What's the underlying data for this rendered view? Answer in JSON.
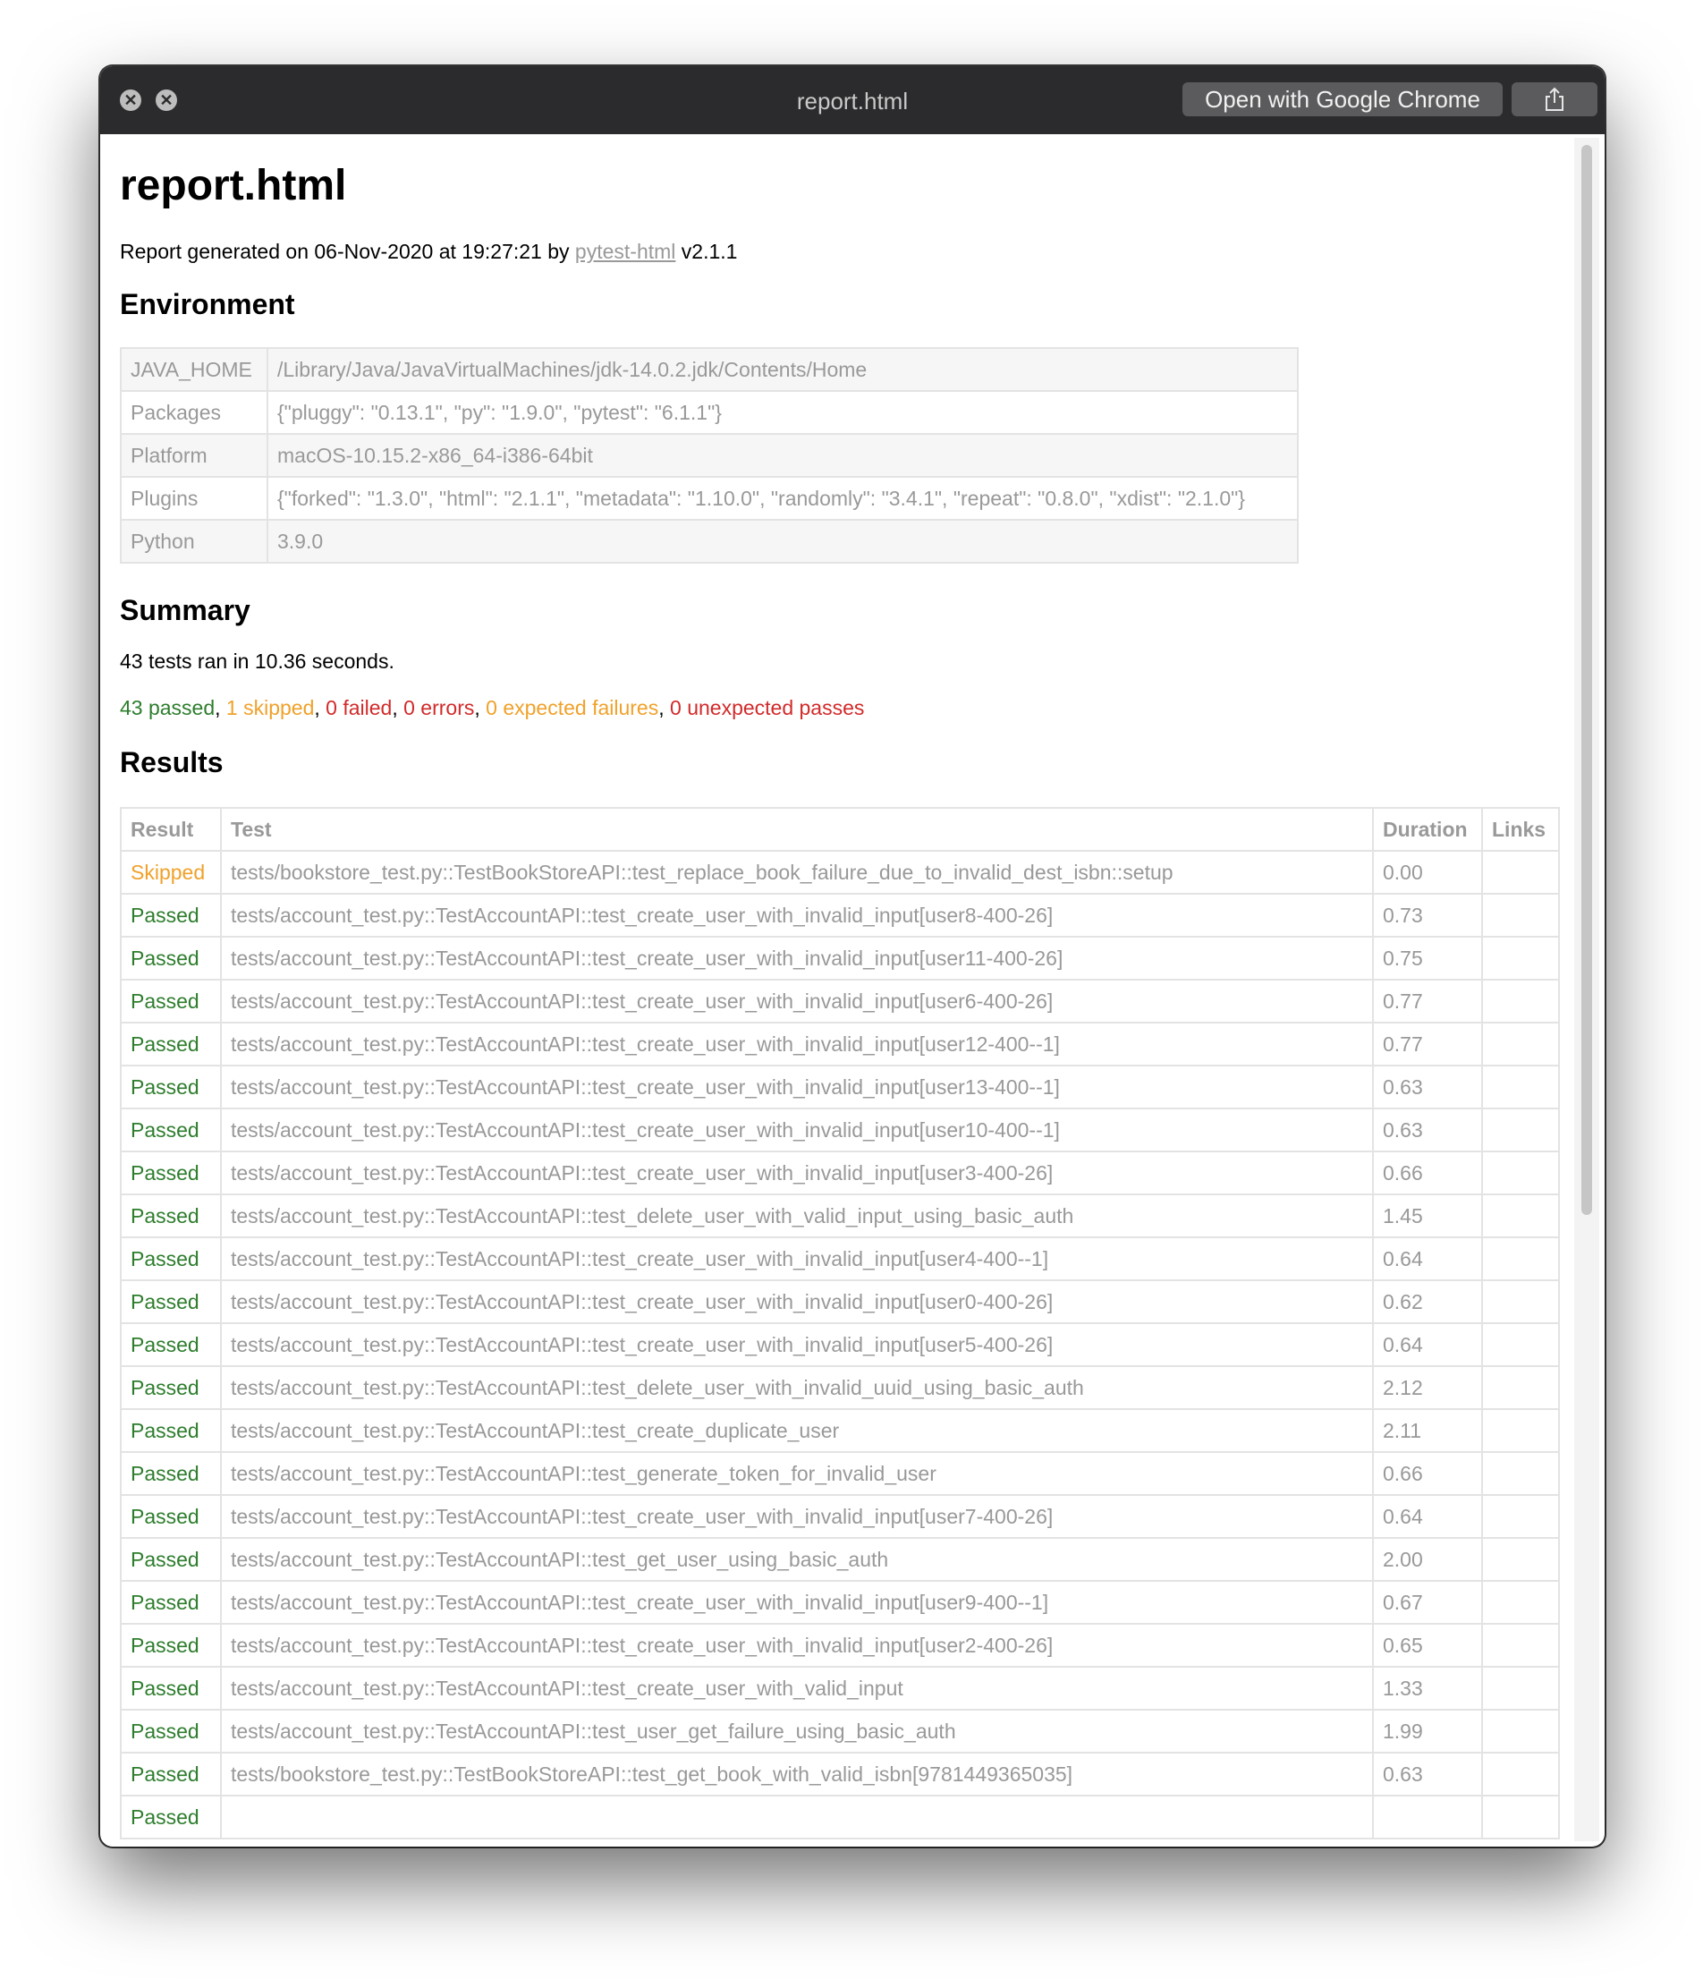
{
  "window": {
    "title": "report.html",
    "open_button": "Open with Google Chrome",
    "close_glyph": "✕",
    "minimize_glyph": "✕"
  },
  "page": {
    "heading": "report.html",
    "generated_prefix": "Report generated on 06-Nov-2020 at 19:27:21 by ",
    "generator_link": "pytest-html",
    "generated_suffix": " v2.1.1"
  },
  "environment": {
    "heading": "Environment",
    "rows": [
      {
        "key": "JAVA_HOME",
        "value": "/Library/Java/JavaVirtualMachines/jdk-14.0.2.jdk/Contents/Home"
      },
      {
        "key": "Packages",
        "value": "{\"pluggy\": \"0.13.1\", \"py\": \"1.9.0\", \"pytest\": \"6.1.1\"}"
      },
      {
        "key": "Platform",
        "value": "macOS-10.15.2-x86_64-i386-64bit"
      },
      {
        "key": "Plugins",
        "value": "{\"forked\": \"1.3.0\", \"html\": \"2.1.1\", \"metadata\": \"1.10.0\", \"randomly\": \"3.4.1\", \"repeat\": \"0.8.0\", \"xdist\": \"2.1.0\"}"
      },
      {
        "key": "Python",
        "value": "3.9.0"
      }
    ]
  },
  "summary": {
    "heading": "Summary",
    "ran": "43 tests ran in 10.36 seconds.",
    "passed": "43 passed",
    "skipped": "1 skipped",
    "failed": "0 failed",
    "errors": "0 errors",
    "xfailed": "0 expected failures",
    "xpassed": "0 unexpected passes",
    "sep": ", "
  },
  "results": {
    "heading": "Results",
    "columns": [
      "Result",
      "Test",
      "Duration",
      "Links"
    ],
    "rows": [
      {
        "result": "Skipped",
        "test": "tests/bookstore_test.py::TestBookStoreAPI::test_replace_book_failure_due_to_invalid_dest_isbn::setup",
        "duration": "0.00",
        "links": ""
      },
      {
        "result": "Passed",
        "test": "tests/account_test.py::TestAccountAPI::test_create_user_with_invalid_input[user8-400-26]",
        "duration": "0.73",
        "links": ""
      },
      {
        "result": "Passed",
        "test": "tests/account_test.py::TestAccountAPI::test_create_user_with_invalid_input[user11-400-26]",
        "duration": "0.75",
        "links": ""
      },
      {
        "result": "Passed",
        "test": "tests/account_test.py::TestAccountAPI::test_create_user_with_invalid_input[user6-400-26]",
        "duration": "0.77",
        "links": ""
      },
      {
        "result": "Passed",
        "test": "tests/account_test.py::TestAccountAPI::test_create_user_with_invalid_input[user12-400--1]",
        "duration": "0.77",
        "links": ""
      },
      {
        "result": "Passed",
        "test": "tests/account_test.py::TestAccountAPI::test_create_user_with_invalid_input[user13-400--1]",
        "duration": "0.63",
        "links": ""
      },
      {
        "result": "Passed",
        "test": "tests/account_test.py::TestAccountAPI::test_create_user_with_invalid_input[user10-400--1]",
        "duration": "0.63",
        "links": ""
      },
      {
        "result": "Passed",
        "test": "tests/account_test.py::TestAccountAPI::test_create_user_with_invalid_input[user3-400-26]",
        "duration": "0.66",
        "links": ""
      },
      {
        "result": "Passed",
        "test": "tests/account_test.py::TestAccountAPI::test_delete_user_with_valid_input_using_basic_auth",
        "duration": "1.45",
        "links": ""
      },
      {
        "result": "Passed",
        "test": "tests/account_test.py::TestAccountAPI::test_create_user_with_invalid_input[user4-400--1]",
        "duration": "0.64",
        "links": ""
      },
      {
        "result": "Passed",
        "test": "tests/account_test.py::TestAccountAPI::test_create_user_with_invalid_input[user0-400-26]",
        "duration": "0.62",
        "links": ""
      },
      {
        "result": "Passed",
        "test": "tests/account_test.py::TestAccountAPI::test_create_user_with_invalid_input[user5-400-26]",
        "duration": "0.64",
        "links": ""
      },
      {
        "result": "Passed",
        "test": "tests/account_test.py::TestAccountAPI::test_delete_user_with_invalid_uuid_using_basic_auth",
        "duration": "2.12",
        "links": ""
      },
      {
        "result": "Passed",
        "test": "tests/account_test.py::TestAccountAPI::test_create_duplicate_user",
        "duration": "2.11",
        "links": ""
      },
      {
        "result": "Passed",
        "test": "tests/account_test.py::TestAccountAPI::test_generate_token_for_invalid_user",
        "duration": "0.66",
        "links": ""
      },
      {
        "result": "Passed",
        "test": "tests/account_test.py::TestAccountAPI::test_create_user_with_invalid_input[user7-400-26]",
        "duration": "0.64",
        "links": ""
      },
      {
        "result": "Passed",
        "test": "tests/account_test.py::TestAccountAPI::test_get_user_using_basic_auth",
        "duration": "2.00",
        "links": ""
      },
      {
        "result": "Passed",
        "test": "tests/account_test.py::TestAccountAPI::test_create_user_with_invalid_input[user9-400--1]",
        "duration": "0.67",
        "links": ""
      },
      {
        "result": "Passed",
        "test": "tests/account_test.py::TestAccountAPI::test_create_user_with_invalid_input[user2-400-26]",
        "duration": "0.65",
        "links": ""
      },
      {
        "result": "Passed",
        "test": "tests/account_test.py::TestAccountAPI::test_create_user_with_valid_input",
        "duration": "1.33",
        "links": ""
      },
      {
        "result": "Passed",
        "test": "tests/account_test.py::TestAccountAPI::test_user_get_failure_using_basic_auth",
        "duration": "1.99",
        "links": ""
      },
      {
        "result": "Passed",
        "test": "tests/bookstore_test.py::TestBookStoreAPI::test_get_book_with_valid_isbn[9781449365035]",
        "duration": "0.63",
        "links": ""
      },
      {
        "result": "Passed",
        "test": "",
        "duration": "",
        "links": ""
      }
    ]
  },
  "colors": {
    "passed": "#2d7d2d",
    "skipped": "#f0a12a",
    "failed": "#d22a2a",
    "titlebar": "#2b2b2d"
  }
}
